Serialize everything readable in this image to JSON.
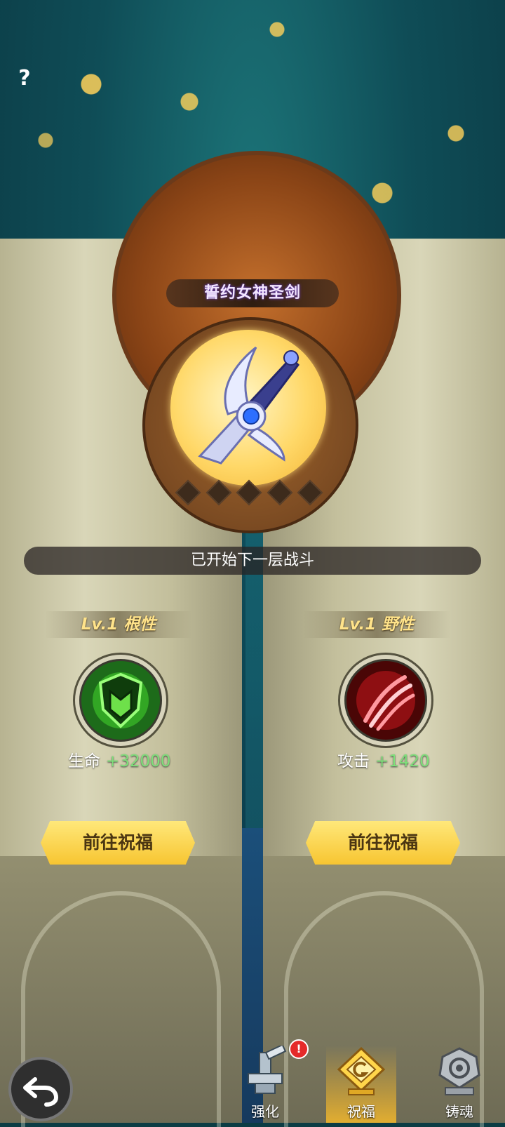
{
  "help_button": "?",
  "weapon": {
    "name": "誓约女神圣剑",
    "star_slots": 5
  },
  "status_text": "已开始下一层战斗",
  "left_blessing": {
    "level_label": "Lv.1 根性",
    "stat_name": "生命",
    "stat_value": "+32000",
    "button_label": "前往祝福",
    "icon": "green-shield-icon"
  },
  "right_blessing": {
    "level_label": "Lv.1 野性",
    "stat_name": "攻击",
    "stat_value": "+1420",
    "button_label": "前往祝福",
    "icon": "red-claw-icon"
  },
  "bottom_nav": {
    "tabs": [
      {
        "label": "强化",
        "icon": "anvil-icon",
        "badge": "!"
      },
      {
        "label": "祝福",
        "icon": "blessing-emblem-icon",
        "active": true
      },
      {
        "label": "铸魂",
        "icon": "soul-forge-icon"
      }
    ]
  },
  "colors": {
    "stat_value": "#7ee07a",
    "level_label": "#ffe38a",
    "button": "#f7c531",
    "badge": "#e52a2a"
  }
}
